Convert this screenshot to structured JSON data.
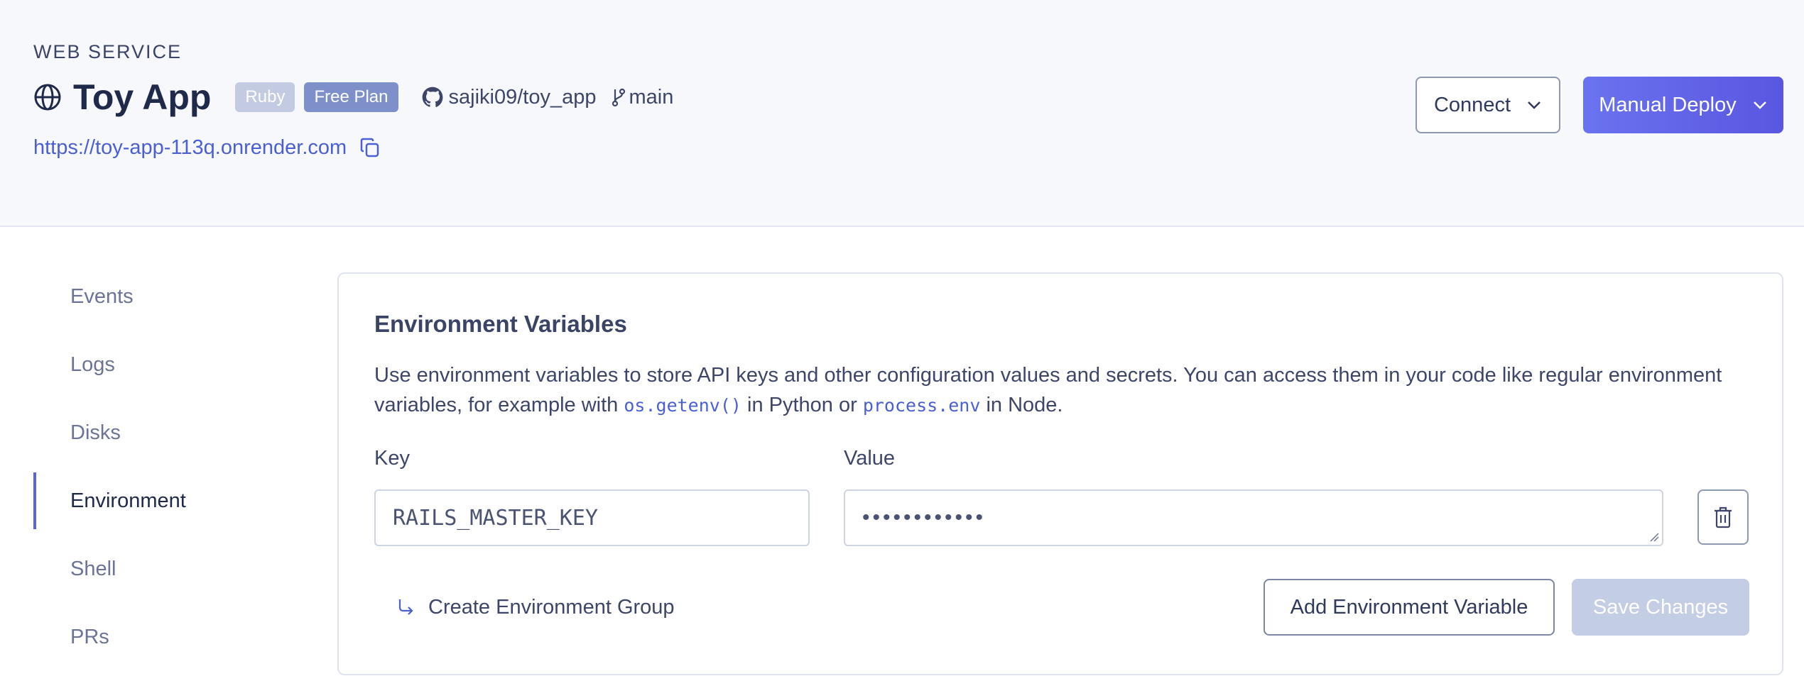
{
  "header": {
    "service_type": "WEB SERVICE",
    "title": "Toy App",
    "badges": [
      "Ruby",
      "Free Plan"
    ],
    "repo": "sajiki09/toy_app",
    "branch": "main",
    "url": "https://toy-app-113q.onrender.com",
    "connect_label": "Connect",
    "deploy_label": "Manual Deploy"
  },
  "sidebar": {
    "items": [
      {
        "label": "Events"
      },
      {
        "label": "Logs"
      },
      {
        "label": "Disks"
      },
      {
        "label": "Environment",
        "active": true
      },
      {
        "label": "Shell"
      },
      {
        "label": "PRs"
      }
    ]
  },
  "env": {
    "title": "Environment Variables",
    "desc_part1": "Use environment variables to store API keys and other configuration values and secrets. You can access them in your code like regular environment variables, for example with ",
    "code1": "os.getenv()",
    "desc_part2": " in Python or ",
    "code2": "process.env",
    "desc_part3": " in Node.",
    "key_label": "Key",
    "value_label": "Value",
    "key_value": "RAILS_MASTER_KEY",
    "value_masked": "••••••••••••",
    "create_group_label": "Create Environment Group",
    "add_label": "Add Environment Variable",
    "save_label": "Save Changes"
  },
  "colors": {
    "accent": "#5b63d8",
    "link": "#4a5fd1",
    "badge_ruby": "#c3cbe2",
    "badge_plan": "#7d90c9",
    "save_disabled": "#c3cde4"
  }
}
